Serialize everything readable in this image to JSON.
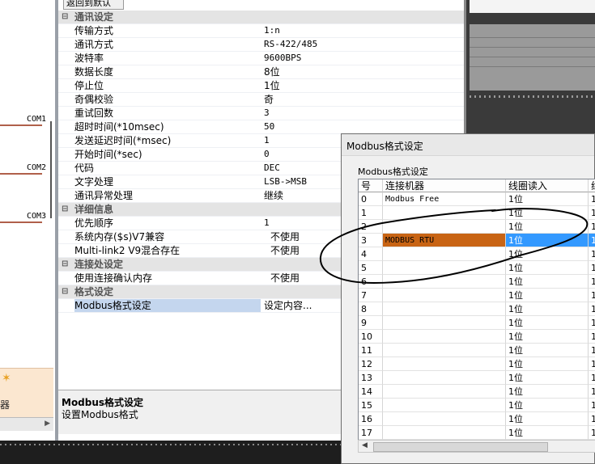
{
  "left_canvas": {
    "com_labels": [
      "COM1",
      "COM2",
      "COM3"
    ],
    "tool_tile_label": "器"
  },
  "panel": {
    "header": "返回到默认",
    "groups": [
      {
        "title": "通讯设定",
        "rows": [
          {
            "name": "传输方式",
            "value": "1:n"
          },
          {
            "name": "通讯方式",
            "value": "RS-422/485"
          },
          {
            "name": "波特率",
            "value": "9600BPS"
          },
          {
            "name": "数据长度",
            "value": "8位"
          },
          {
            "name": "停止位",
            "value": "1位"
          },
          {
            "name": "奇偶校验",
            "value": "奇"
          },
          {
            "name": "重试回数",
            "value": "3"
          },
          {
            "name": "超时时间(*10msec)",
            "value": "50"
          },
          {
            "name": "发送延迟时间(*msec)",
            "value": "1"
          },
          {
            "name": "开始时间(*sec)",
            "value": "0"
          },
          {
            "name": "代码",
            "value": "DEC"
          },
          {
            "name": "文字处理",
            "value": "LSB->MSB"
          },
          {
            "name": "通讯异常处理",
            "value": "继续"
          }
        ]
      },
      {
        "title": "详细信息",
        "rows": [
          {
            "name": "优先顺序",
            "value": "1"
          },
          {
            "name": "系统内存($s)V7兼容",
            "value": "不使用"
          },
          {
            "name": "Multi-link2 V9混合存在",
            "value": "不使用"
          }
        ]
      },
      {
        "title": "连接处设定",
        "rows": [
          {
            "name": "使用连接确认内存",
            "value": "不使用"
          }
        ]
      },
      {
        "title": "格式设定",
        "rows": [
          {
            "name": "Modbus格式设定",
            "value": "设定内容..."
          }
        ]
      }
    ],
    "description": {
      "title": "Modbus格式设定",
      "text": "设置Modbus格式"
    }
  },
  "dialog": {
    "title": "Modbus格式设定",
    "group_label": "Modbus格式设定",
    "columns": [
      "号",
      "连接机器",
      "线圈读入",
      "线"
    ],
    "rows": [
      {
        "no": "0",
        "device": "Modbus Free",
        "coil": "1位",
        "x": "1"
      },
      {
        "no": "1",
        "device": "",
        "coil": "1位",
        "x": "1"
      },
      {
        "no": "2",
        "device": "",
        "coil": "1位",
        "x": "1"
      },
      {
        "no": "3",
        "device": "MODBUS RTU",
        "coil": "1位",
        "x": "1"
      },
      {
        "no": "4",
        "device": "",
        "coil": "1位",
        "x": "1"
      },
      {
        "no": "5",
        "device": "",
        "coil": "1位",
        "x": "1"
      },
      {
        "no": "6",
        "device": "",
        "coil": "1位",
        "x": "1"
      },
      {
        "no": "7",
        "device": "",
        "coil": "1位",
        "x": "1"
      },
      {
        "no": "8",
        "device": "",
        "coil": "1位",
        "x": "1"
      },
      {
        "no": "9",
        "device": "",
        "coil": "1位",
        "x": "1"
      },
      {
        "no": "10",
        "device": "",
        "coil": "1位",
        "x": "1"
      },
      {
        "no": "11",
        "device": "",
        "coil": "1位",
        "x": "1"
      },
      {
        "no": "12",
        "device": "",
        "coil": "1位",
        "x": "1"
      },
      {
        "no": "13",
        "device": "",
        "coil": "1位",
        "x": "1"
      },
      {
        "no": "14",
        "device": "",
        "coil": "1位",
        "x": "1"
      },
      {
        "no": "15",
        "device": "",
        "coil": "1位",
        "x": "1"
      },
      {
        "no": "16",
        "device": "",
        "coil": "1位",
        "x": "1"
      },
      {
        "no": "17",
        "device": "",
        "coil": "1位",
        "x": "1"
      }
    ],
    "selected_row": 3
  },
  "colors": {
    "selected_device_cell": "#c86414",
    "selected_row": "#3399ff",
    "property_selected": "#c4d6ee",
    "annotation_ink": "#000000"
  },
  "icons": [
    "triangle-collapse-icon",
    "scroll-left-arrow-icon",
    "scroll-right-arrow-icon"
  ]
}
